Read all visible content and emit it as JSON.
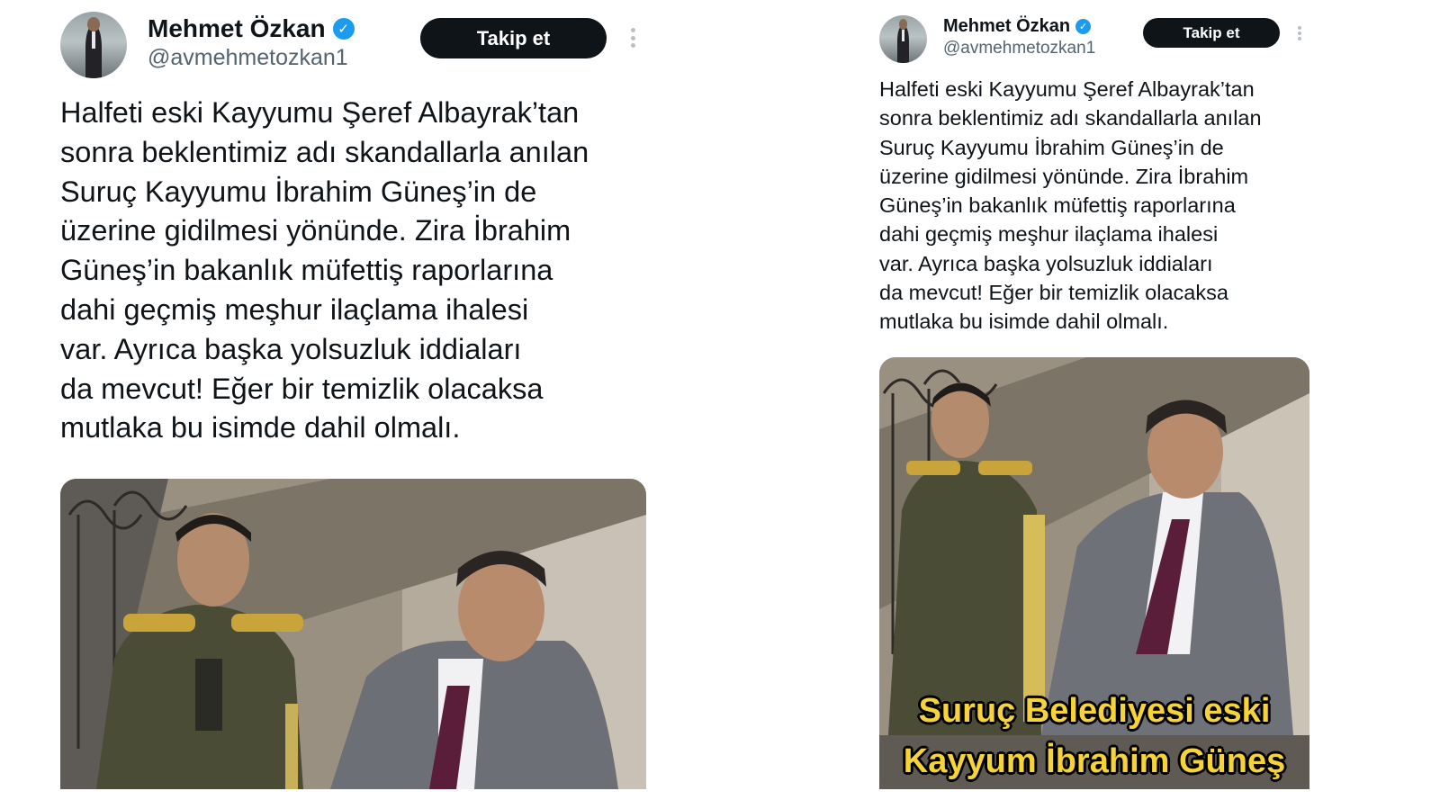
{
  "tweet": {
    "author_name": "Mehmet Özkan",
    "verified_glyph": "✓",
    "handle": "@avmehmetozkan1",
    "follow_label": "Takip et",
    "more_icon": "more-vertical-icon",
    "lines": [
      "Halfeti eski Kayyumu Şeref Albayrak’tan",
      "sonra beklentimiz adı skandallarla anılan",
      "Suruç Kayyumu İbrahim Güneş’in de",
      "üzerine gidilmesi yönünde. Zira İbrahim",
      "Güneş’in bakanlık müfettiş raporlarına",
      "dahi geçmiş meşhur ilaçlama ihalesi",
      "var. Ayrıca başka yolsuzluk iddiaları",
      "da mevcut! Eğer bir temizlik olacaksa",
      "mutlaka bu isimde dahil olmalı."
    ],
    "video_caption_lines": [
      "Suruç Belediyesi eski",
      "Kayyum İbrahim Güneş"
    ]
  },
  "colors": {
    "text": "#0f1419",
    "secondary": "#536471",
    "verified": "#1d9bf0",
    "button_bg": "#0f1419",
    "caption": "#f7d33a"
  }
}
